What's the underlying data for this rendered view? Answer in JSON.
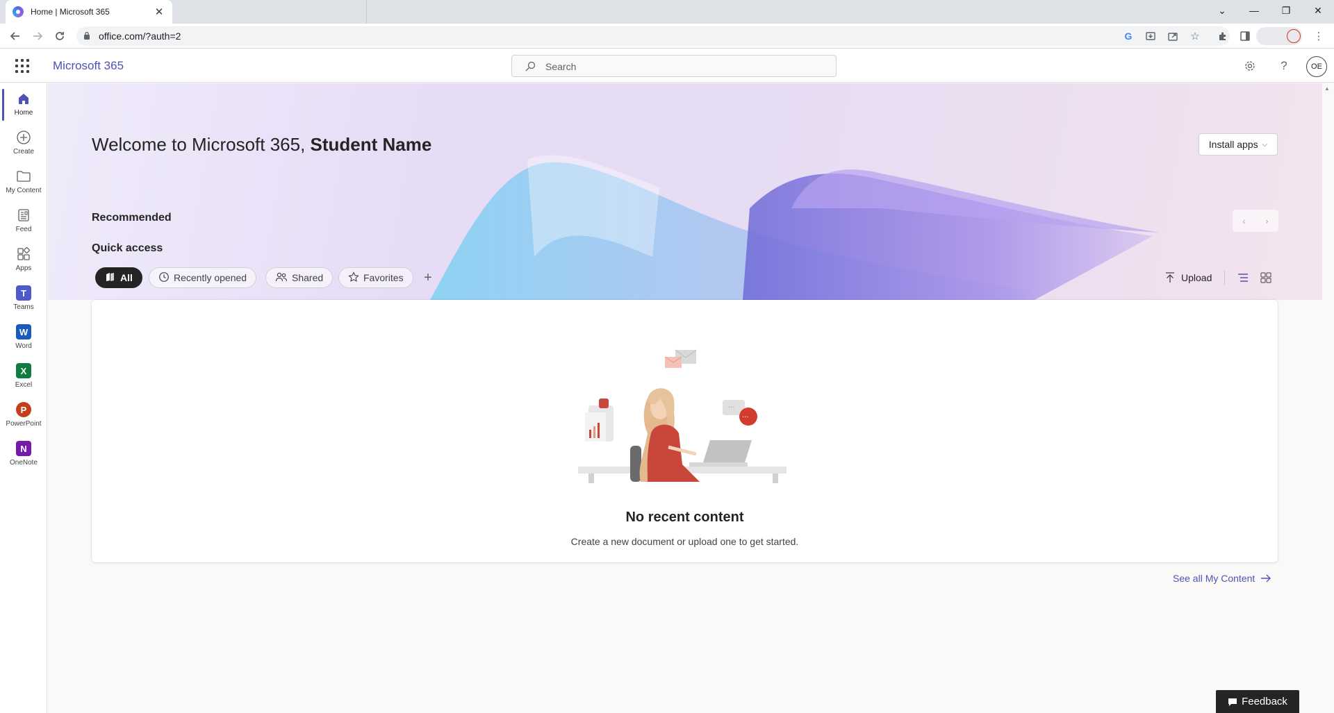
{
  "browser": {
    "tab_title": "Home | Microsoft 365",
    "url": "office.com/?auth=2",
    "icons": [
      "back-icon",
      "forward-icon",
      "reload-icon",
      "lock-icon",
      "google-icon",
      "install-icon",
      "share-icon",
      "star-icon",
      "extensions-icon",
      "sidepanel-icon",
      "menu-icon"
    ]
  },
  "header": {
    "brand": "Microsoft 365",
    "search_placeholder": "Search",
    "avatar_initials": "OE"
  },
  "rail": {
    "items": [
      {
        "label": "Home",
        "icon": "home-icon"
      },
      {
        "label": "Create",
        "icon": "create-icon"
      },
      {
        "label": "My Content",
        "icon": "folder-icon"
      },
      {
        "label": "Feed",
        "icon": "feed-icon"
      },
      {
        "label": "Apps",
        "icon": "apps-icon"
      },
      {
        "label": "Teams",
        "icon": "teams-icon",
        "color": "#5059c9"
      },
      {
        "label": "Word",
        "icon": "word-icon",
        "color": "#185abd"
      },
      {
        "label": "Excel",
        "icon": "excel-icon",
        "color": "#107c41"
      },
      {
        "label": "PowerPoint",
        "icon": "powerpoint-icon",
        "color": "#c43e1c"
      },
      {
        "label": "OneNote",
        "icon": "onenote-icon",
        "color": "#7719aa"
      }
    ]
  },
  "main": {
    "welcome_prefix": "Welcome to Microsoft 365,",
    "user_name": "Student Name",
    "install_apps": "Install apps",
    "recommended_title": "Recommended",
    "quick_access_title": "Quick access",
    "filters": [
      {
        "label": "All",
        "active": true
      },
      {
        "label": "Recently opened",
        "active": false
      },
      {
        "label": "Shared",
        "active": false
      },
      {
        "label": "Favorites",
        "active": false
      }
    ],
    "upload_label": "Upload",
    "empty_title": "No recent content",
    "empty_subtitle": "Create a new document or upload one to get started.",
    "see_all": "See all My Content",
    "feedback": "Feedback"
  },
  "colors": {
    "brand": "#4f52b2",
    "active_pill": "#242424"
  }
}
